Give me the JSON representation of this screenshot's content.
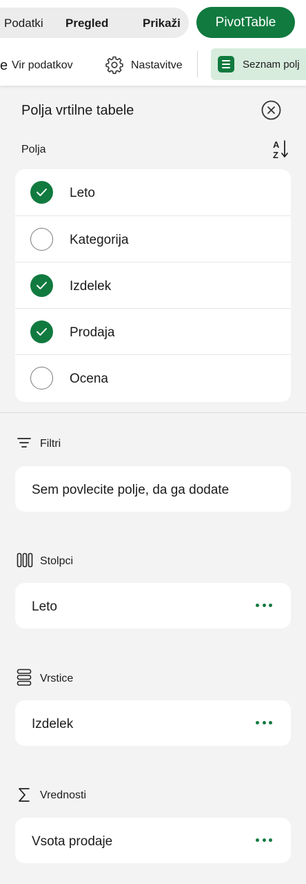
{
  "ribbon": {
    "tabs": [
      {
        "label": "Podatki"
      },
      {
        "label": "Pregled"
      },
      {
        "label": "Prikaži"
      }
    ],
    "pivot_button": "PivotTable"
  },
  "toolbar": {
    "partial_glyph": "e",
    "data_source": "Vir podatkov",
    "settings": "Nastavitve",
    "field_list": "Seznam polj"
  },
  "pane": {
    "title": "Polja vrtilne tabele",
    "fields_label": "Polja",
    "fields": [
      {
        "name": "Leto",
        "checked": true
      },
      {
        "name": "Kategorija",
        "checked": false
      },
      {
        "name": "Izdelek",
        "checked": true
      },
      {
        "name": "Prodaja",
        "checked": true
      },
      {
        "name": "Ocena",
        "checked": false
      }
    ]
  },
  "areas": {
    "filters": {
      "label": "Filtri",
      "placeholder": "Sem povlecite polje, da ga dodate"
    },
    "columns": {
      "label": "Stolpci",
      "item": "Leto"
    },
    "rows": {
      "label": "Vrstice",
      "item": "Izdelek"
    },
    "values": {
      "label": "Vrednosti",
      "item": "Vsota prodaje"
    }
  },
  "icons": {
    "gear": "gear-icon",
    "list": "list-icon",
    "close": "close-icon",
    "sort": "sort-az-icon",
    "filter": "filter-icon",
    "columns": "columns-icon",
    "rows": "rows-icon",
    "sum": "sigma-icon",
    "more": "more-horizontal-icon",
    "check": "checkmark-icon"
  },
  "colors": {
    "accent": "#117a3f",
    "accent_light": "#d7ecdd",
    "pane_bg": "#f3f3f3",
    "card_bg": "#ffffff"
  }
}
